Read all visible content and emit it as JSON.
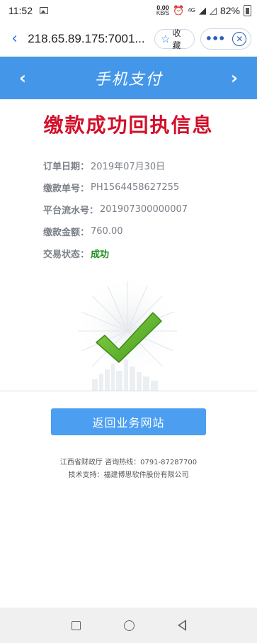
{
  "status_bar": {
    "time": "11:52",
    "net_speed_value": "0.00",
    "net_speed_unit": "KB/S",
    "network": "4G",
    "battery_percent": "82%"
  },
  "browser": {
    "url": "218.65.89.175:7001...",
    "favorite_label": "收藏"
  },
  "header": {
    "title": "手机支付",
    "back_arrow": "‹",
    "forward_arrow": "›"
  },
  "receipt": {
    "title": "缴款成功回执信息",
    "rows": [
      {
        "label": "订单日期：",
        "value": "2019年07月30日"
      },
      {
        "label": "缴款单号：",
        "value": "PH1564458627255"
      },
      {
        "label": "平台流水号：",
        "value": "201907300000007"
      },
      {
        "label": "缴款金额：",
        "value": "760.00"
      },
      {
        "label": "交易状态：",
        "value": "成功"
      }
    ]
  },
  "actions": {
    "return_label": "返回业务网站"
  },
  "footer": {
    "line1": "江西省财政厅 咨询热线：0791-87287700",
    "line2": "技术支持：福建博思软件股份有限公司"
  },
  "colors": {
    "header_bg": "#4496e9",
    "title_red": "#d2112a",
    "success_green": "#1d8f1d",
    "button_blue": "#4b9ef0"
  },
  "icons": [
    "gallery-icon",
    "alarm-icon",
    "signal-icon",
    "battery-icon",
    "back-chevron-icon",
    "star-icon",
    "more-icon",
    "close-circle-icon",
    "checkmark-icon",
    "nav-square-icon",
    "nav-home-icon",
    "nav-back-icon"
  ]
}
